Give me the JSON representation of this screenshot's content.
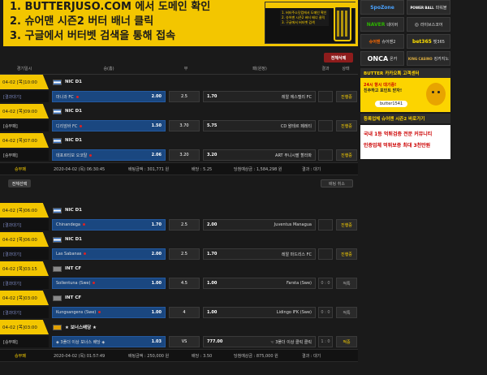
{
  "banner": {
    "lines": [
      "1. BUTTERJUSO.COM 에서 도메인 확인",
      "2. 슈어맨 시즌2 버터 배너 클릭",
      "3. 구글에서 버터벳 검색을 통해 접속"
    ],
    "thumb_text": "1. 버터주소닷컴에서 도메인 확인 2. 슈어맨 시즌2 버터 배너 클릭 3. 구글에서 버터벳 검색"
  },
  "side": {
    "rows": [
      [
        {
          "logo": "SpoZone",
          "label": ""
        },
        {
          "logo": "POWER BALL",
          "label": "파워볼"
        }
      ],
      [
        {
          "logo": "NAVER",
          "label": "네이버"
        },
        {
          "logo": "◎",
          "label": "라이브스코어"
        }
      ],
      [
        {
          "logo": "슈어맨",
          "label": "슈어맨2"
        },
        {
          "logo": "bet365",
          "label": "벳365"
        }
      ],
      [
        {
          "logo": "ONCA",
          "label": "온카"
        },
        {
          "logo": "KING CASINO",
          "label": "킹카지노"
        }
      ]
    ],
    "kakao_head": "BUTTER 카카오톡 고객센터",
    "kakao_line1": "24시 항시 대기중!",
    "kakao_line2": "친추하고 포인트 받자!",
    "kakao_id": "butter1541",
    "ad_head": "등록업체 슈어맨 시즌2 바로가기",
    "ad_line1": "국내 1등 먹튀검증 전문 커뮤니티",
    "ad_line2": "인증업체 먹튀보증 최대 3천만원"
  },
  "toolbar": {
    "delete_label": "전체삭제"
  },
  "header": [
    "경기일시",
    "승(홈)",
    "무",
    "패(원정)",
    "결과",
    "상태"
  ],
  "slips": [
    {
      "events": [
        {
          "date": "04-02 [목]10:00",
          "league": "NIC D1",
          "flag": "nic",
          "time": "[결과대기]",
          "time_white": false,
          "home": "마나과 FC",
          "home_odds": "2.00",
          "draw": "2.5",
          "away_odds": "1.70",
          "away": "레알 에스텔리 FC",
          "sel": "home",
          "score": "",
          "status": "진행중"
        },
        {
          "date": "04-02 [목]09:00",
          "league": "NIC D1",
          "flag": "nic",
          "time": "[승무패]",
          "time_white": true,
          "home": "디리암바 FC",
          "home_odds": "1.50",
          "draw": "3.70",
          "away_odds": "5.75",
          "away": "CD 왈테르 페레티",
          "sel": "home",
          "score": "",
          "status": "진행중"
        },
        {
          "date": "04-02 [목]07:00",
          "league": "NIC D1",
          "flag": "nic",
          "time": "[승무패]",
          "time_white": true,
          "home": "데포르티보 오코탈",
          "home_odds": "2.06",
          "draw": "3.20",
          "away_odds": "3.20",
          "away": "ART 무니시팔 할라파",
          "sel": "home",
          "score": "",
          "status": "진행중"
        }
      ],
      "summary": {
        "label": "승무패",
        "date": "2020-04-02 (목) 06:30:45",
        "bet": "배팅금액 : 301,771 원",
        "rate": "배당 : 5.25",
        "win": "당첨예상금 : 1,584,298 원",
        "result": "결과 : 대기"
      }
    },
    {
      "events": [
        {
          "date": "04-02 [목]06:00",
          "league": "NIC D1",
          "flag": "nic",
          "time": "[결과대기]",
          "time_white": false,
          "home": "Chinandega",
          "home_odds": "1.70",
          "draw": "2.5",
          "away_odds": "2.00",
          "away": "Juventus Managua",
          "sel": "home",
          "score": "",
          "status": "진행중"
        },
        {
          "date": "04-02 [목]06:00",
          "league": "NIC D1",
          "flag": "nic",
          "time": "[결과대기]",
          "time_white": false,
          "home": "Las Sabanas",
          "home_odds": "2.00",
          "draw": "2.5",
          "away_odds": "1.70",
          "away": "레알 마드리스 FC",
          "sel": "home",
          "score": "",
          "status": "진행중"
        },
        {
          "date": "04-02 [목]03:15",
          "league": "INT CF",
          "flag": "int",
          "time": "[결과대기]",
          "time_white": false,
          "home": "Sollentuna (Swe)",
          "home_odds": "1.00",
          "draw": "4.5",
          "away_odds": "1.00",
          "away": "Farsta (Swe)",
          "sel": "home",
          "score": "0 : 0",
          "status": "적특"
        },
        {
          "date": "04-02 [목]03:00",
          "league": "INT CF",
          "flag": "int",
          "time": "[결과대기]",
          "time_white": false,
          "home": "Kungsangens (Swe)",
          "home_odds": "1.00",
          "draw": "4",
          "away_odds": "1.00",
          "away": "Lidingo IFK (Swe)",
          "sel": "home",
          "score": "0 : 0",
          "status": "적특"
        },
        {
          "date": "04-02 [목]03:00",
          "league": "★ 보너스배당 ★",
          "flag": "bonus",
          "time": "[승무패]",
          "time_white": true,
          "home": "◈ 3폴더 이상 보너스 배당 ◈",
          "home_odds": "1.03",
          "draw": "VS",
          "away_odds": "777.00",
          "away": "☜ 3폴더 이상 클릭 클릭",
          "sel": "home",
          "score": "1 : 0",
          "status": "적중"
        }
      ],
      "summary": {
        "label": "승무패",
        "date": "2020-04-02 (목) 01:57:49",
        "bet": "배팅금액 : 250,000 원",
        "rate": "배당 : 3.50",
        "win": "당첨예상금 : 875,000 원",
        "result": "결과 : 대기"
      }
    }
  ],
  "actions": {
    "select_all": "전체선택",
    "cancel": "배팅 취소"
  }
}
